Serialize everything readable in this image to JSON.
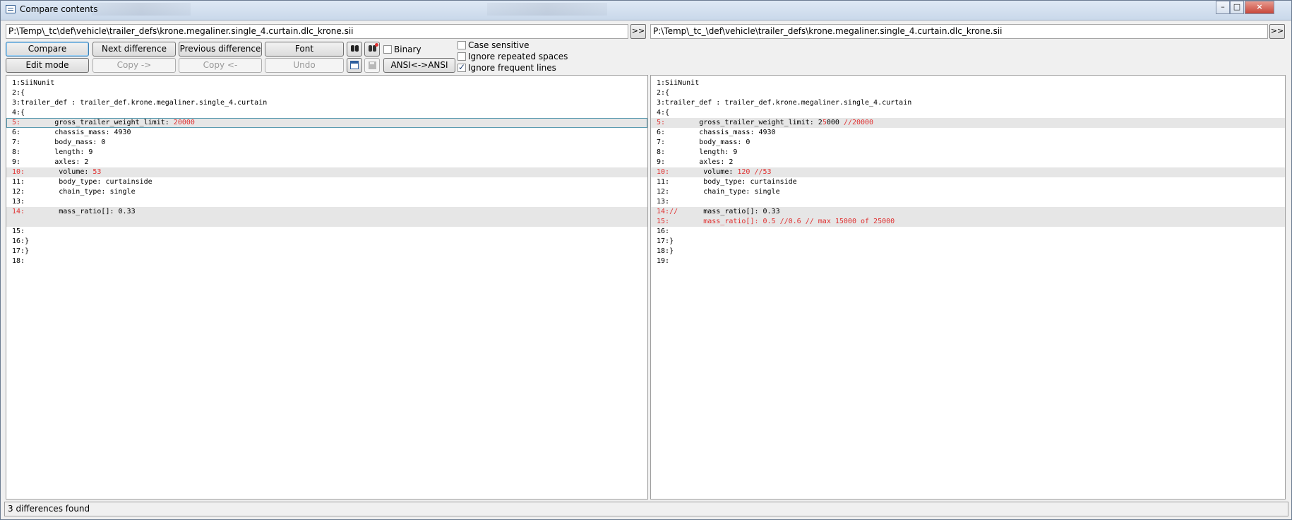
{
  "window": {
    "title": "Compare contents"
  },
  "left_path": "P:\\Temp\\_tc\\def\\vehicle\\trailer_defs\\krone.megaliner.single_4.curtain.dlc_krone.sii",
  "right_path": "P:\\Temp\\_tc_\\def\\vehicle\\trailer_defs\\krone.megaliner.single_4.curtain.dlc_krone.sii",
  "browse_label": ">>",
  "buttons": {
    "compare": "Compare",
    "next": "Next difference",
    "prev": "Previous difference",
    "font": "Font",
    "edit": "Edit mode",
    "copy_right": "Copy ->",
    "copy_left": "Copy <-",
    "undo": "Undo",
    "ansi": "ANSI<->ANSI"
  },
  "options": {
    "binary": {
      "label": "Binary",
      "checked": false
    },
    "case_sensitive": {
      "label": "Case sensitive",
      "checked": false
    },
    "ignore_spaces": {
      "label": "Ignore repeated spaces",
      "checked": false
    },
    "ignore_frequent": {
      "label": "Ignore frequent lines",
      "checked": true
    }
  },
  "left_lines": [
    {
      "num": "1:",
      "parts": [
        {
          "t": "SiiNunit"
        }
      ]
    },
    {
      "num": "2:",
      "parts": [
        {
          "t": "{"
        }
      ]
    },
    {
      "num": "3:",
      "parts": [
        {
          "t": "trailer_def : trailer_def.krone.megaliner.single_4.curtain"
        }
      ]
    },
    {
      "num": "4:",
      "parts": [
        {
          "t": "{"
        }
      ]
    },
    {
      "num": "5:",
      "diff": true,
      "focus": true,
      "parts": [
        {
          "t": "        gross_trailer_weight_limit: "
        },
        {
          "t": "20000",
          "red": true
        }
      ]
    },
    {
      "num": "6:",
      "parts": [
        {
          "t": "        chassis_mass: 4930"
        }
      ]
    },
    {
      "num": "7:",
      "parts": [
        {
          "t": "        body_mass: 0"
        }
      ]
    },
    {
      "num": "8:",
      "parts": [
        {
          "t": "        length: 9"
        }
      ]
    },
    {
      "num": "9:",
      "parts": [
        {
          "t": "        axles: 2"
        }
      ]
    },
    {
      "num": "10:",
      "diff": true,
      "parts": [
        {
          "t": "        volume: "
        },
        {
          "t": "53",
          "red": true
        }
      ]
    },
    {
      "num": "11:",
      "parts": [
        {
          "t": "        body_type: curtainside"
        }
      ]
    },
    {
      "num": "12:",
      "parts": [
        {
          "t": "        chain_type: single"
        }
      ]
    },
    {
      "num": "13:",
      "parts": []
    },
    {
      "num": "14:",
      "diff": true,
      "parts": [
        {
          "t": "        mass_ratio[]: 0.33"
        }
      ]
    },
    {
      "num": "",
      "diff": true,
      "parts": []
    },
    {
      "num": "15:",
      "parts": []
    },
    {
      "num": "16:",
      "parts": [
        {
          "t": "}"
        }
      ]
    },
    {
      "num": "17:",
      "parts": [
        {
          "t": "}"
        }
      ]
    },
    {
      "num": "18:",
      "parts": []
    }
  ],
  "right_lines": [
    {
      "num": "1:",
      "parts": [
        {
          "t": "SiiNunit"
        }
      ]
    },
    {
      "num": "2:",
      "parts": [
        {
          "t": "{"
        }
      ]
    },
    {
      "num": "3:",
      "parts": [
        {
          "t": "trailer_def : trailer_def.krone.megaliner.single_4.curtain"
        }
      ]
    },
    {
      "num": "4:",
      "parts": [
        {
          "t": "{"
        }
      ]
    },
    {
      "num": "5:",
      "diff": true,
      "parts": [
        {
          "t": "        gross_trailer_weight_limit: 2"
        },
        {
          "t": "5",
          "red": true
        },
        {
          "t": "000 "
        },
        {
          "t": "//20000",
          "red": true
        }
      ]
    },
    {
      "num": "6:",
      "parts": [
        {
          "t": "        chassis_mass: 4930"
        }
      ]
    },
    {
      "num": "7:",
      "parts": [
        {
          "t": "        body_mass: 0"
        }
      ]
    },
    {
      "num": "8:",
      "parts": [
        {
          "t": "        length: 9"
        }
      ]
    },
    {
      "num": "9:",
      "parts": [
        {
          "t": "        axles: 2"
        }
      ]
    },
    {
      "num": "10:",
      "diff": true,
      "parts": [
        {
          "t": "        volume: "
        },
        {
          "t": "120 //53",
          "red": true
        }
      ]
    },
    {
      "num": "11:",
      "parts": [
        {
          "t": "        body_type: curtainside"
        }
      ]
    },
    {
      "num": "12:",
      "parts": [
        {
          "t": "        chain_type: single"
        }
      ]
    },
    {
      "num": "13:",
      "parts": []
    },
    {
      "num": "14:",
      "diff": true,
      "parts": [
        {
          "t": "//",
          "red": true
        },
        {
          "t": "      mass_ratio[]: 0.33"
        }
      ]
    },
    {
      "num": "15:",
      "diff": true,
      "parts": [
        {
          "t": "        mass_ratio[]: 0.5 //0.6 // max 15000 of 25000",
          "red": true
        }
      ]
    },
    {
      "num": "16:",
      "parts": []
    },
    {
      "num": "17:",
      "parts": [
        {
          "t": "}"
        }
      ]
    },
    {
      "num": "18:",
      "parts": [
        {
          "t": "}"
        }
      ]
    },
    {
      "num": "19:",
      "parts": []
    }
  ],
  "status": "3 differences found"
}
